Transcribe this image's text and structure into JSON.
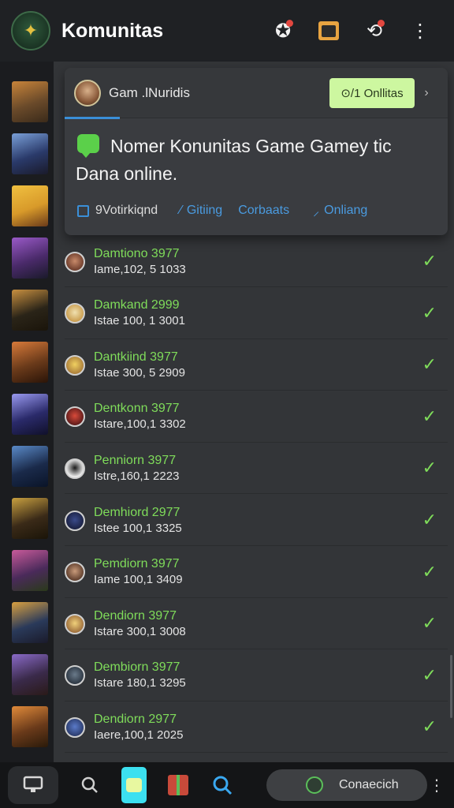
{
  "header": {
    "title": "Komunitas",
    "logo_icon": "game-controller-icon",
    "actions": [
      {
        "name": "ninja-icon",
        "glyph": "✪",
        "badge": true
      },
      {
        "name": "tv-icon",
        "glyph": "",
        "badge": false
      },
      {
        "name": "share-icon",
        "glyph": "⟲",
        "badge": true
      },
      {
        "name": "more-icon",
        "glyph": "⋮",
        "badge": false
      }
    ]
  },
  "rail": {
    "thumbs": [
      {
        "colors": [
          "#6a4a2a",
          "#c8843a",
          "#3a2a1a"
        ]
      },
      {
        "colors": [
          "#2a3a6a",
          "#7aa0d8",
          "#1a1a2a"
        ]
      },
      {
        "colors": [
          "#d89a2a",
          "#f0c040",
          "#6a3a1a"
        ]
      },
      {
        "colors": [
          "#4a2a6a",
          "#9a5ac8",
          "#1a1a2a"
        ]
      },
      {
        "colors": [
          "#2a2418",
          "#c89040",
          "#1a140a"
        ]
      },
      {
        "colors": [
          "#6a3a1a",
          "#d87a3a",
          "#2a1408"
        ]
      },
      {
        "colors": [
          "#2a2a6a",
          "#9a9af0",
          "#10102a"
        ]
      },
      {
        "colors": [
          "#1a2a4a",
          "#5a8ac8",
          "#0a1428"
        ]
      },
      {
        "colors": [
          "#3a2a18",
          "#c8a040",
          "#1a1408"
        ]
      },
      {
        "colors": [
          "#4a2a5a",
          "#c85a9a",
          "#2a3a1a"
        ]
      },
      {
        "colors": [
          "#2a3a5a",
          "#d8a040",
          "#1a1a2a"
        ]
      },
      {
        "colors": [
          "#3a2a4a",
          "#8a6ac8",
          "#2a1a18"
        ]
      },
      {
        "colors": [
          "#6a3a1a",
          "#e08a3a",
          "#2a1a0a"
        ]
      }
    ]
  },
  "popup": {
    "title": "Gam .lNuridis",
    "online_button": "⊙/1 Onllitas",
    "chevron": "›",
    "message_line1": "Nomer Konunitas Game Gamey tic",
    "message_line2": "Dana online.",
    "links": {
      "checkbox_label": "9Votirkiqnd",
      "link1": "Gitiing",
      "link2": "Corbaats",
      "link3": "Onliang"
    }
  },
  "rows": [
    {
      "name": "Damtiono 3977",
      "sub": "Iame,102, 5 1033",
      "avatar": [
        "#c88a6a",
        "#6a3a2a"
      ]
    },
    {
      "name": "Damkand 2999",
      "sub": "Istae 100, 1 3001",
      "avatar": [
        "#f0e0b0",
        "#c89a4a"
      ]
    },
    {
      "name": "Dantkiind 3977",
      "sub": "Istae 300, 5 2909",
      "avatar": [
        "#f0d060",
        "#a87a3a"
      ]
    },
    {
      "name": "Dentkonn 3977",
      "sub": "Istare,100,1 3302",
      "avatar": [
        "#d84a3a",
        "#5a1a1a"
      ]
    },
    {
      "name": "Penniorn 3977",
      "sub": "Istre,160,1 2223",
      "avatar": [
        "#1a1a1a",
        "#ffffff"
      ]
    },
    {
      "name": "Demhiord 2977",
      "sub": "Istee 100,1 3325",
      "avatar": [
        "#3a4a8a",
        "#1a2040"
      ]
    },
    {
      "name": "Pemdiorn 3977",
      "sub": "Iame 100,1 3409",
      "avatar": [
        "#c89a7a",
        "#5a3a2a"
      ]
    },
    {
      "name": "Dendiorn 3977",
      "sub": "Istare 300,1 3008",
      "avatar": [
        "#f0d07a",
        "#9a6a3a"
      ]
    },
    {
      "name": "Dembiorn 3977",
      "sub": "Istare 180,1 3295",
      "avatar": [
        "#6a7a8a",
        "#2a3440"
      ]
    },
    {
      "name": "Dendiorn 2977",
      "sub": "Iaere,100,1 2025",
      "avatar": [
        "#5a7ac8",
        "#2a3a6a"
      ]
    }
  ],
  "bottom": {
    "connect_label": "Conaecich",
    "more": "⋮"
  }
}
